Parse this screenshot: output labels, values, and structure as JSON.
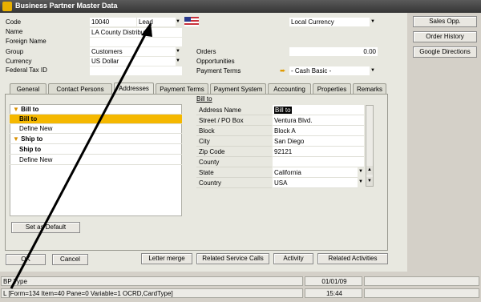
{
  "window": {
    "title": "Business Partner Master Data"
  },
  "header": {
    "code_label": "Code",
    "code_value": "10040",
    "type_value": "Lead",
    "name_label": "Name",
    "name_value": "LA County Distributor",
    "foreign_name_label": "Foreign Name",
    "foreign_name_value": "",
    "group_label": "Group",
    "group_value": "Customers",
    "currency_label": "Currency",
    "currency_value": "US Dollar",
    "federal_tax_label": "Federal Tax ID",
    "federal_tax_value": "",
    "local_currency": "Local Currency",
    "orders_label": "Orders",
    "orders_value": "0.00",
    "opportunities_label": "Opportunities",
    "payment_terms_label": "Payment Terms",
    "payment_terms_value": "- Cash Basic -"
  },
  "side_buttons": [
    "Sales Opp.",
    "Order History",
    "Google Directions"
  ],
  "tabs": [
    "General",
    "Contact Persons",
    "Addresses",
    "Payment Terms",
    "Payment System",
    "Accounting",
    "Properties",
    "Remarks"
  ],
  "address_list": {
    "bill_to_group": "Bill to",
    "bill_to_item": "Bill to",
    "bill_to_new": "Define New",
    "ship_to_group": "Ship to",
    "ship_to_item": "Ship to",
    "ship_to_new": "Define New",
    "set_default": "Set as Default"
  },
  "address_grid": {
    "heading": "Bill to",
    "rows": [
      {
        "label": "Address Name",
        "value": "Bill to"
      },
      {
        "label": "Street / PO Box",
        "value": "Ventura Blvd."
      },
      {
        "label": "Block",
        "value": "Block A"
      },
      {
        "label": "City",
        "value": "San Diego"
      },
      {
        "label": "Zip Code",
        "value": "92121"
      },
      {
        "label": "County",
        "value": ""
      },
      {
        "label": "State",
        "value": "California"
      },
      {
        "label": "Country",
        "value": "USA"
      }
    ]
  },
  "buttons": {
    "ok": "OK",
    "cancel": "Cancel",
    "letter_merge": "Letter merge",
    "related_service_calls": "Related Service Calls",
    "activity": "Activity",
    "related_activities": "Related Activities"
  },
  "status": {
    "line1": "BP Type",
    "line2": "L [Form=134 Item=40 Pane=0 Variable=1 OCRD,CardType]",
    "date": "01/01/09",
    "time": "15:44"
  },
  "colors": {
    "title_bar": "#3d3d3d",
    "selected_row": "#f5b800",
    "field_highlight": "#fdf6b0",
    "window_bg": "#e8e8e0"
  }
}
